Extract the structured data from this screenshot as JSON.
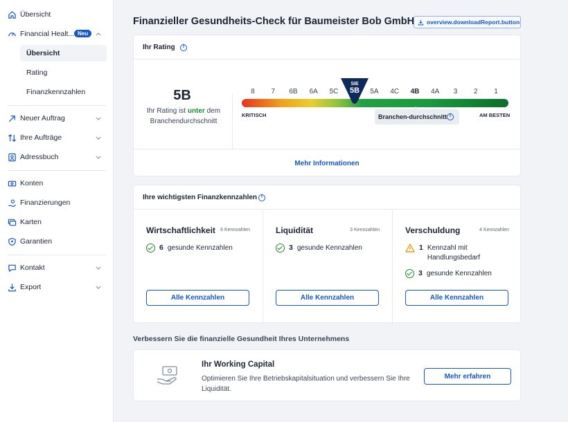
{
  "sidebar": {
    "items": [
      {
        "label": "Übersicht",
        "icon": "home-icon"
      },
      {
        "label": "Financial Healt...",
        "icon": "gauge-icon",
        "badge": "Neu"
      },
      {
        "label": "Neuer Auftrag",
        "icon": "arrow-up-right-icon"
      },
      {
        "label": "Ihre Aufträge",
        "icon": "swap-arrows-icon"
      },
      {
        "label": "Adressbuch",
        "icon": "address-book-icon"
      },
      {
        "label": "Konten",
        "icon": "money-icon"
      },
      {
        "label": "Finanzierungen",
        "icon": "hand-coins-icon"
      },
      {
        "label": "Karten",
        "icon": "cards-icon"
      },
      {
        "label": "Garantien",
        "icon": "shield-icon"
      },
      {
        "label": "Kontakt",
        "icon": "chat-icon"
      },
      {
        "label": "Export",
        "icon": "download-icon"
      }
    ],
    "sub_items": [
      {
        "label": "Übersicht",
        "active": true
      },
      {
        "label": "Rating",
        "active": false
      },
      {
        "label": "Finanzkennzahlen",
        "active": false
      }
    ]
  },
  "header": {
    "title": "Finanzieller Gesundheits-Check für Baumeister Bob GmbH",
    "download_button": "overview.downloadReport.button"
  },
  "rating": {
    "section_title": "Ihr Rating",
    "value": "5B",
    "text_before": "Ihr Rating ist ",
    "text_highlight": "unter",
    "text_after": " dem Branchendurchschnitt",
    "scale": [
      "8",
      "7",
      "6B",
      "6A",
      "5C",
      "5B",
      "5A",
      "4C",
      "4B",
      "4A",
      "3",
      "2",
      "1"
    ],
    "marker_label": "SIE",
    "marker_value": "5B",
    "left_label": "KRITISCH",
    "right_label": "AM BESTEN",
    "industry_label": "Branchen-durchschnitt",
    "industry_value": "4B",
    "more_link": "Mehr Informationen"
  },
  "kpis": {
    "section_title": "Ihre wichtigsten Finanzkennzahlen",
    "columns": [
      {
        "title": "Wirtschaftlichkeit",
        "count": "6 Kennzahlen",
        "healthy_count": "6",
        "healthy_label": "gesunde Kennzahlen",
        "button": "Alle Kennzahlen"
      },
      {
        "title": "Liquidität",
        "count": "3 Kennzahlen",
        "healthy_count": "3",
        "healthy_label": "gesunde Kennzahlen",
        "button": "Alle Kennzahlen"
      },
      {
        "title": "Verschuldung",
        "count": "4 Kennzahlen",
        "warning_count": "1",
        "warning_label": "Kennzahl mit Handlungsbedarf",
        "healthy_count": "3",
        "healthy_label": "gesunde Kennzahlen",
        "button": "Alle Kennzahlen"
      }
    ]
  },
  "improve": {
    "section_title": "Verbessern Sie die finanzielle Gesundheit Ihres Unternehmens",
    "title": "Ihr Working Capital",
    "text": "Optimieren Sie Ihre Betriebskapitalsituation und verbessern Sie Ihre Liquidität.",
    "button": "Mehr erfahren"
  },
  "colors": {
    "accent": "#1757c2",
    "positive": "#1a8a2e",
    "warning": "#e8a317",
    "marker": "#0e2a5c"
  }
}
